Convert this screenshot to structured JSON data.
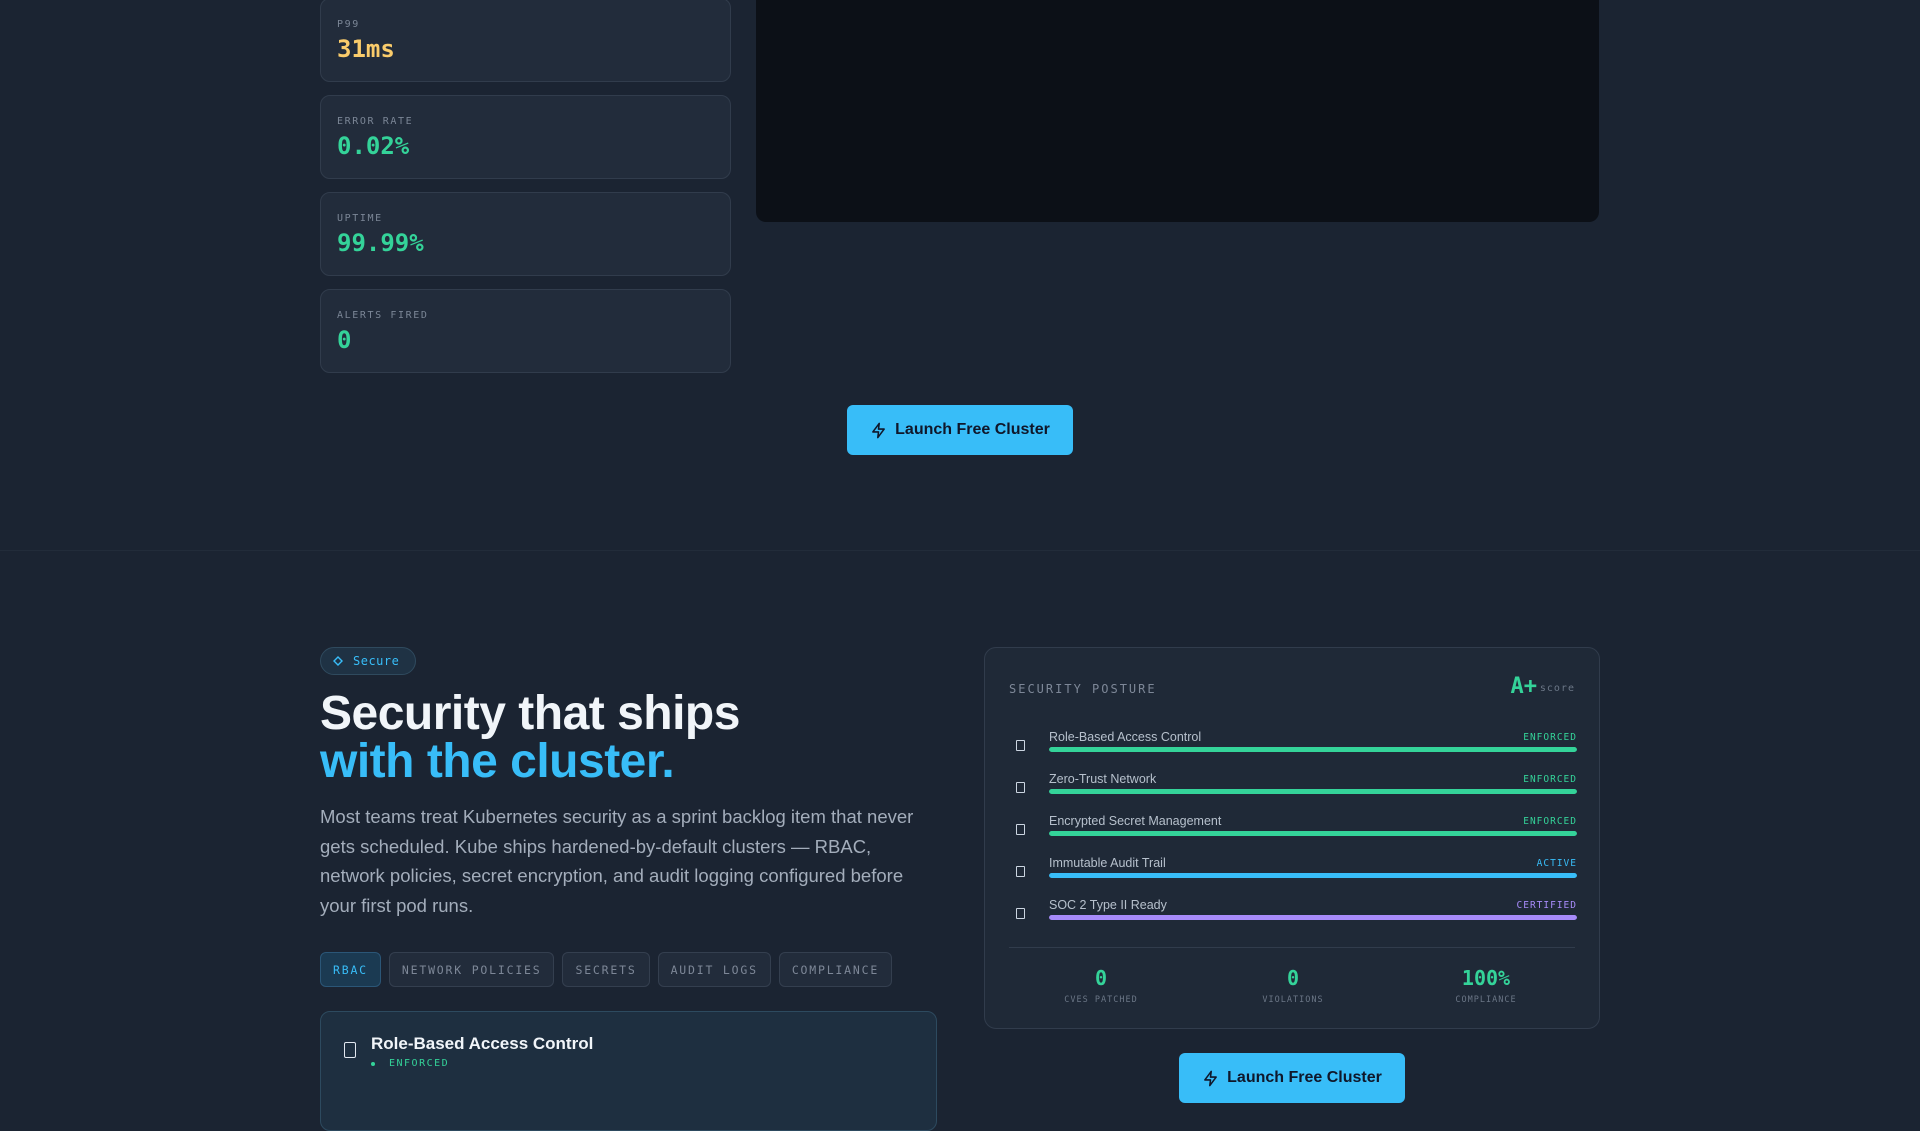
{
  "metrics": [
    {
      "label": "P99",
      "value": "31ms",
      "color": "#facc6b"
    },
    {
      "label": "ERROR RATE",
      "value": "0.02%",
      "color": "#34d399"
    },
    {
      "label": "UPTIME",
      "value": "99.99%",
      "color": "#34d399"
    },
    {
      "label": "ALERTS FIRED",
      "value": "0",
      "color": "#34d399"
    }
  ],
  "cta": {
    "label": "Launch Free Cluster",
    "icon": "lightning-icon"
  },
  "security": {
    "badge": {
      "label": "Secure",
      "icon": "diamond-icon"
    },
    "heading_line1": "Security that ships",
    "heading_line2": "with the cluster.",
    "paragraph": "Most teams treat Kubernetes security as a sprint backlog item that never gets scheduled. Kube ships hardened-by-default clusters — RBAC, network policies, secret encryption, and audit logging configured before your first pod runs.",
    "tabs": [
      "RBAC",
      "NETWORK POLICIES",
      "SECRETS",
      "AUDIT LOGS",
      "COMPLIANCE"
    ],
    "active_tab": "RBAC",
    "detail_card": {
      "title": "Role-Based Access Control",
      "status": "ENFORCED",
      "icon": "lock-icon"
    }
  },
  "posture": {
    "title": "SECURITY POSTURE",
    "grade": "A+",
    "grade_suffix": "score",
    "controls": [
      {
        "label": "Role-Based Access Control",
        "status": "ENFORCED",
        "color": "#34d399",
        "level": 100
      },
      {
        "label": "Zero-Trust Network",
        "status": "ENFORCED",
        "color": "#34d399",
        "level": 100
      },
      {
        "label": "Encrypted Secret Management",
        "status": "ENFORCED",
        "color": "#34d399",
        "level": 100
      },
      {
        "label": "Immutable Audit Trail",
        "status": "ACTIVE",
        "color": "#38bdf8",
        "level": 100
      },
      {
        "label": "SOC 2 Type II Ready",
        "status": "CERTIFIED",
        "color": "#a78bfa",
        "level": 100
      }
    ],
    "stats": [
      {
        "value": "0",
        "label": "CVES PATCHED"
      },
      {
        "value": "0",
        "label": "VIOLATIONS"
      },
      {
        "value": "100%",
        "label": "COMPLIANCE"
      }
    ]
  },
  "colors": {
    "accent": "#38bdf8",
    "success": "#34d399",
    "warning": "#facc6b",
    "purple": "#a78bfa"
  }
}
